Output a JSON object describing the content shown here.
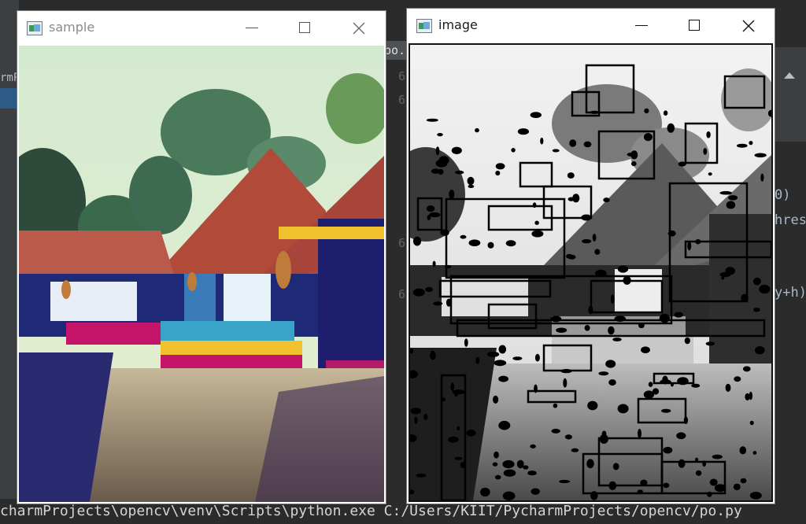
{
  "ide": {
    "left_tab_text": "rmP",
    "tab_fragment": "po.py",
    "code_fragments": [
      "0)",
      "hres",
      "y+h)"
    ],
    "line_numbers": [
      "6",
      "6",
      "6",
      "6"
    ]
  },
  "terminal": {
    "command": "charmProjects\\opencv\\venv\\Scripts\\python.exe C:/Users/KIIT/PycharmProjects/opencv/po.py"
  },
  "windows": {
    "sample": {
      "title": "sample",
      "icon": "opencv-window-icon",
      "state": "inactive"
    },
    "image": {
      "title": "image",
      "icon": "opencv-window-icon",
      "state": "active"
    }
  },
  "colors": {
    "ide_bg": "#2b2b2b",
    "ide_panel": "#3c3f41",
    "selection": "#2d5b87",
    "sky": "#d9ecd4",
    "roof": "#b24a3a",
    "shadow_blue": "#1e1e6e",
    "magenta": "#c4156a",
    "yellow": "#f2c12e"
  }
}
